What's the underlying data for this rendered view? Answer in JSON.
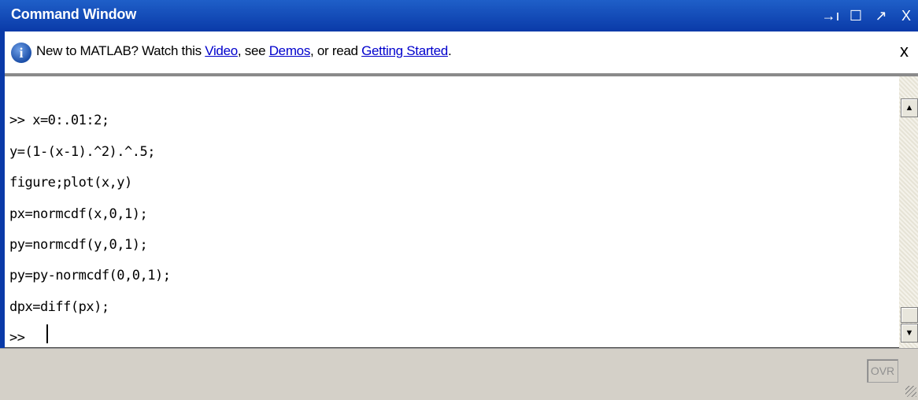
{
  "window": {
    "title": "Command Window",
    "controls": {
      "undock": "→ı",
      "maximize": "☐",
      "restore": "↗",
      "close": "X"
    }
  },
  "infobar": {
    "prefix": "New to MATLAB? Watch this ",
    "link_video": "Video",
    "mid1": ", see ",
    "link_demos": "Demos",
    "mid2": ", or read ",
    "link_getting_started": "Getting Started",
    "suffix": ".",
    "close": "x"
  },
  "console": {
    "lines": [
      ">> x=0:.01:2;",
      "y=(1-(x-1).^2).^.5;",
      "figure;plot(x,y)",
      "px=normcdf(x,0,1);",
      "py=normcdf(y,0,1);",
      "py=py-normcdf(0,0,1);",
      "dpx=diff(px);",
      ">> "
    ]
  },
  "scrollbar": {
    "up": "▲",
    "down": "▼"
  },
  "status": {
    "ovr": "OVR"
  },
  "colors": {
    "titlebar": "#0a3aa8",
    "link": "#0000cc"
  }
}
